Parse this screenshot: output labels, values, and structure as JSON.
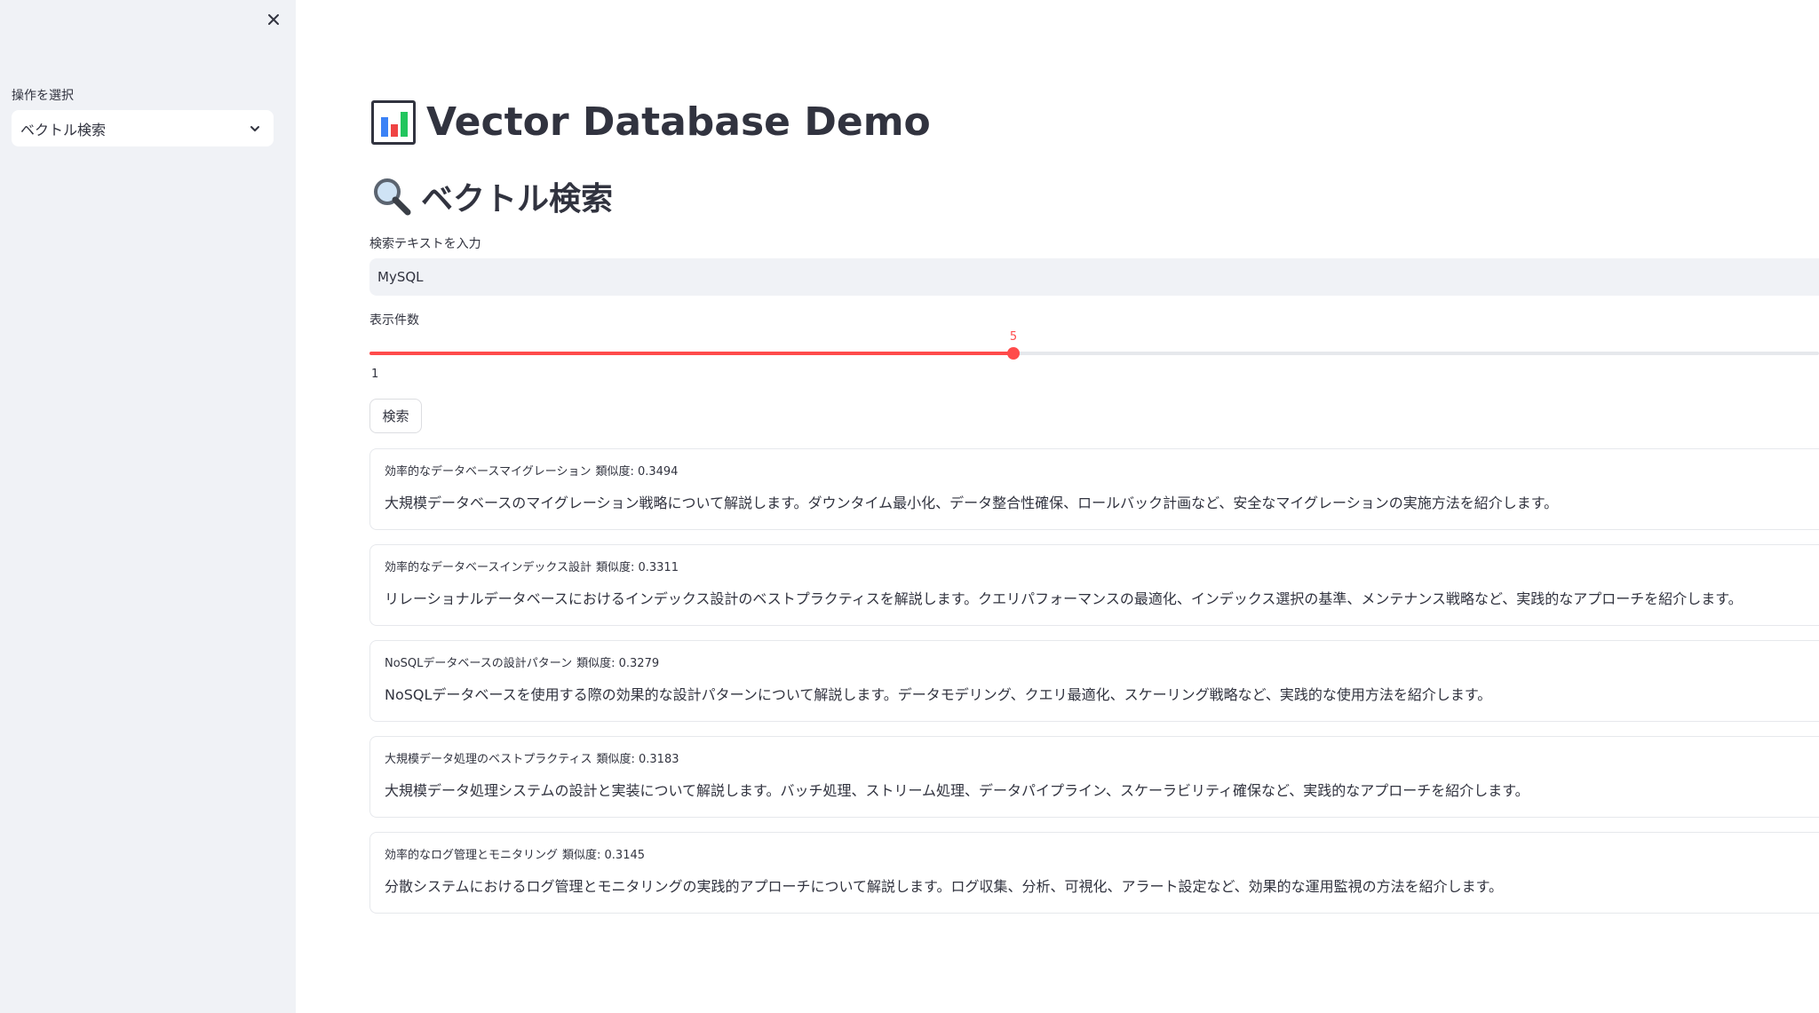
{
  "sidebar": {
    "select_label": "操作を選択",
    "select_value": "ベクトル検索"
  },
  "header": {
    "title": "Vector Database Demo",
    "title_icon": "bar-chart-icon"
  },
  "section": {
    "title": "ベクトル検索",
    "title_icon": "magnifier-icon"
  },
  "search": {
    "label": "検索テキストを入力",
    "value": "MySQL"
  },
  "slider": {
    "label": "表示件数",
    "value": "5",
    "min_label": "1",
    "fill_fraction": 0.4444
  },
  "search_button": "検索",
  "results": [
    {
      "title": "効率的なデータベースマイグレーション",
      "score_label": "類似度: 0.3494",
      "body": "大規模データベースのマイグレーション戦略について解説します。ダウンタイム最小化、データ整合性確保、ロールバック計画など、安全なマイグレーションの実施方法を紹介します。"
    },
    {
      "title": "効率的なデータベースインデックス設計",
      "score_label": "類似度: 0.3311",
      "body": "リレーショナルデータベースにおけるインデックス設計のベストプラクティスを解説します。クエリパフォーマンスの最適化、インデックス選択の基準、メンテナンス戦略など、実践的なアプローチを紹介します。"
    },
    {
      "title": "NoSQLデータベースの設計パターン",
      "score_label": "類似度: 0.3279",
      "body": "NoSQLデータベースを使用する際の効果的な設計パターンについて解説します。データモデリング、クエリ最適化、スケーリング戦略など、実践的な使用方法を紹介します。"
    },
    {
      "title": "大規模データ処理のベストプラクティス",
      "score_label": "類似度: 0.3183",
      "body": "大規模データ処理システムの設計と実装について解説します。バッチ処理、ストリーム処理、データパイプライン、スケーラビリティ確保など、実践的なアプローチを紹介します。"
    },
    {
      "title": "効率的なログ管理とモニタリング",
      "score_label": "類似度: 0.3145",
      "body": "分散システムにおけるログ管理とモニタリングの実践的アプローチについて解説します。ログ収集、分析、可視化、アラート設定など、効果的な運用監視の方法を紹介します。"
    }
  ],
  "colors": {
    "accent": "#ff4b4b",
    "sidebar_bg": "#f0f2f6",
    "text": "#31333f"
  }
}
